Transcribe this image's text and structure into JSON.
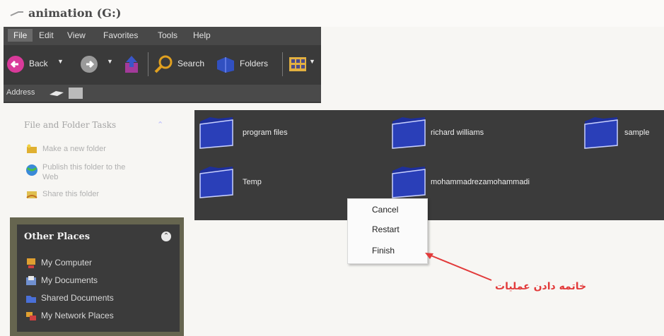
{
  "window": {
    "title": "animation (G:)"
  },
  "menubar": [
    "File",
    "Edit",
    "View",
    "Favorites",
    "Tools",
    "Help"
  ],
  "toolbar": {
    "back": "Back",
    "search": "Search",
    "folders": "Folders"
  },
  "addressbar": {
    "label": "Address"
  },
  "task_pane": {
    "title": "File and Folder Tasks",
    "items": [
      "Make a new folder",
      "Publish this folder to the",
      "Web",
      "Share this folder"
    ]
  },
  "other_places": {
    "title": "Other Places",
    "items": [
      "My Computer",
      "My Documents",
      "Shared Documents",
      "My Network Places"
    ]
  },
  "folders": [
    "program files",
    "richard williams",
    "sample",
    "Temp",
    "mohammadrezamohammadi"
  ],
  "context_menu": [
    "Cancel",
    "Restart",
    "Finish"
  ],
  "annotation": "خاتمه دادن عملیات",
  "colors": {
    "dark": "#3b3b3b",
    "folder_blue": "#1e2f9b",
    "annotation_red": "#e23a3a"
  }
}
